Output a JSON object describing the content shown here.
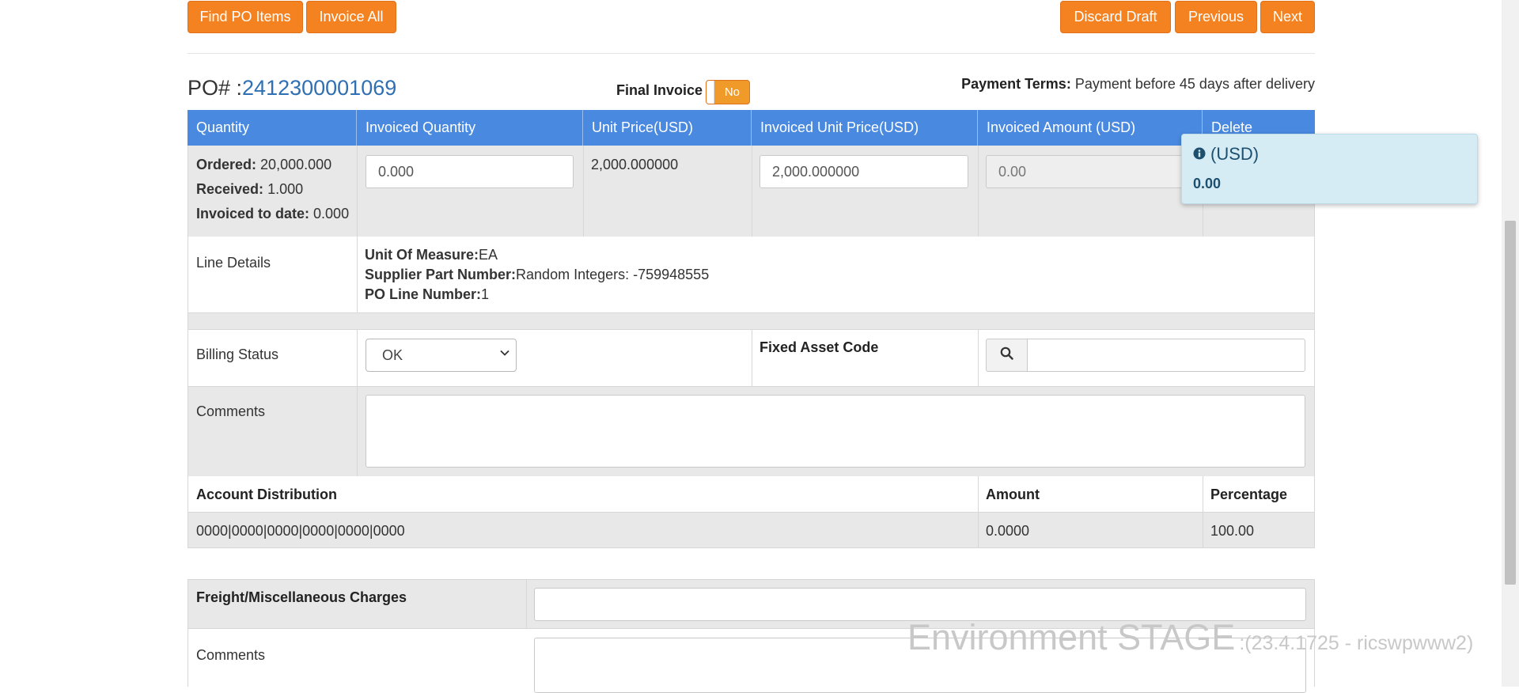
{
  "toolbar": {
    "find_po_items": "Find PO Items",
    "invoice_all": "Invoice All",
    "discard_draft": "Discard Draft",
    "previous": "Previous",
    "next": "Next"
  },
  "po": {
    "label": "PO# :",
    "number": "2412300001069",
    "final_invoice_label": "Final Invoice :",
    "final_invoice_value": "No",
    "payment_terms_label": "Payment Terms:",
    "payment_terms_value": "Payment before 45 days after delivery"
  },
  "line_table": {
    "headers": [
      "Quantity",
      "Invoiced Quantity",
      "Unit Price(USD)",
      "Invoiced Unit Price(USD)",
      "Invoiced Amount (USD)",
      "Delete"
    ],
    "ordered_label": "Ordered:",
    "ordered_value": "20,000.000",
    "received_label": "Received:",
    "received_value": "1.000",
    "invoiced_to_date_label": "Invoiced to date:",
    "invoiced_to_date_value": "0.000",
    "invoiced_quantity": "0.000",
    "unit_price": "2,000.000000",
    "invoiced_unit_price": "2,000.000000",
    "invoiced_amount": "0.00"
  },
  "line_details": {
    "label": "Line Details",
    "uom_label": "Unit Of Measure:",
    "uom_value": "EA",
    "spn_label": "Supplier Part Number:",
    "spn_value": "Random Integers: -759948555",
    "po_line_label": "PO Line Number:",
    "po_line_value": "1"
  },
  "billing": {
    "label": "Billing Status",
    "selected": "OK",
    "fixed_asset_label": "Fixed Asset Code",
    "fixed_asset_value": ""
  },
  "comments": {
    "label": "Comments",
    "value": ""
  },
  "account_distribution": {
    "headers": [
      "Account Distribution",
      "Amount",
      "Percentage"
    ],
    "rows": [
      {
        "account": "0000|0000|0000|0000|0000|0000",
        "amount": "0.0000",
        "percentage": "100.00"
      }
    ]
  },
  "freight": {
    "label": "Freight/Miscellaneous Charges",
    "value": "",
    "comments_label": "Comments"
  },
  "popover": {
    "title": "(USD)",
    "value": "0.00"
  },
  "environment": {
    "name": "Environment STAGE",
    "version": ":(23.4.1725 - ricswpwww2)"
  },
  "colors": {
    "accent_orange": "#f58220",
    "header_blue": "#4a89e0",
    "link_blue": "#2f6fb3",
    "popover_bg": "#d6ecf5"
  }
}
